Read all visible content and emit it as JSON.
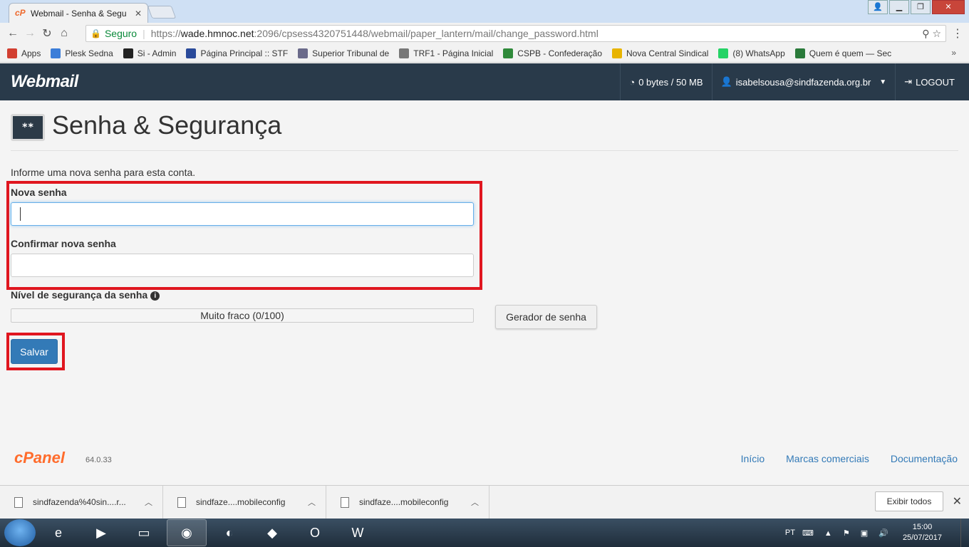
{
  "browser": {
    "tab_title": "Webmail - Senha & Segu",
    "tab_favicon": "cP",
    "url_secure_label": "Seguro",
    "url_scheme": "https://",
    "url_host": "wade.hmnoc.net",
    "url_path": ":2096/cpsess4320751448/webmail/paper_lantern/mail/change_password.html",
    "bookmarks": [
      {
        "label": "Apps",
        "icon": "apps-grid-icon",
        "color": "#d23f31"
      },
      {
        "label": "Plesk Sedna",
        "icon": "plesk-icon",
        "color": "#3b7dd8"
      },
      {
        "label": "Si - Admin",
        "icon": "admin-icon",
        "color": "#222222"
      },
      {
        "label": "Página Principal :: STF",
        "icon": "stf-icon",
        "color": "#2a4a9a"
      },
      {
        "label": "Superior Tribunal de",
        "icon": "stj-icon",
        "color": "#6a6a8a"
      },
      {
        "label": "TRF1 - Página Inicial",
        "icon": "trf1-icon",
        "color": "#777777"
      },
      {
        "label": "CSPB - Confederação",
        "icon": "cspb-icon",
        "color": "#2f8a3a"
      },
      {
        "label": "Nova Central Sindical",
        "icon": "ncst-icon",
        "color": "#e8b400"
      },
      {
        "label": "(8) WhatsApp",
        "icon": "whatsapp-icon",
        "color": "#25d366"
      },
      {
        "label": "Quem é quem — Sec",
        "icon": "quem-icon",
        "color": "#2a7a3a"
      }
    ],
    "bookmarks_more": "»"
  },
  "header": {
    "logo": "Webmail",
    "quota": "0 bytes / 50 MB",
    "user": "isabelsousa@sindfazenda.org.br",
    "logout": "LOGOUT"
  },
  "main": {
    "icon_text": "**",
    "title": "Senha & Segurança",
    "intro": "Informe uma nova senha para esta conta.",
    "new_password_label": "Nova senha",
    "new_password_value": "",
    "confirm_password_label": "Confirmar nova senha",
    "confirm_password_value": "",
    "strength_label": "Nível de segurança da senha",
    "strength_text": "Muito fraco (0/100)",
    "strength_value": 0,
    "generator_button": "Gerador de senha",
    "save_button": "Salvar"
  },
  "footer": {
    "brand": "cPanel",
    "version": "64.0.33",
    "links": [
      "Início",
      "Marcas comerciais",
      "Documentação"
    ]
  },
  "downloads": {
    "items": [
      "sindfazenda%40sin....r...",
      "sindfaze....mobileconfig",
      "sindfaze....mobileconfig"
    ],
    "show_all": "Exibir todos"
  },
  "taskbar": {
    "lang": "PT",
    "time": "15:00",
    "date": "25/07/2017"
  },
  "colors": {
    "header_bg": "#293a4a",
    "accent": "#337ab7",
    "highlight": "#e0161f",
    "cpanel_orange": "#ff6c2c"
  }
}
